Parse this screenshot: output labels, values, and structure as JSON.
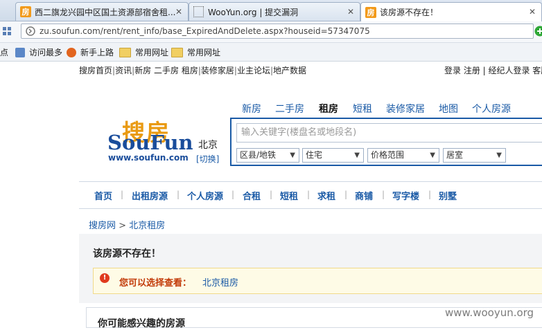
{
  "browser": {
    "tabs": [
      {
        "title": "西二旗龙兴园中区国土资源部宿舍租...",
        "favicon": "房"
      },
      {
        "title": "WooYun.org | 提交漏洞",
        "favicon": ""
      },
      {
        "title": "该房源不存在！",
        "favicon": "房"
      }
    ],
    "url": "zu.soufun.com/rent/rent_info/base_ExpiredAndDelete.aspx?houseid=57347075",
    "bookmarks": [
      "点",
      "访问最多",
      "新手上路",
      "常用网址",
      "常用网址"
    ]
  },
  "site": {
    "top_links": {
      "left": [
        "搜房首页",
        "资讯",
        "新房",
        "二手房",
        "租房",
        "装修家居",
        "业主论坛",
        "地产数据"
      ],
      "right": "登录 注册 | 经纪人登录 客服"
    },
    "logo": {
      "cn": "搜房",
      "en": "SouFun",
      "url": "www.soufun.com"
    },
    "city": "北京",
    "city_switch": "[切换]",
    "channel_tabs": [
      "新房",
      "二手房",
      "租房",
      "短租",
      "装修家居",
      "地图",
      "个人房源"
    ],
    "selected_channel": "租房",
    "search": {
      "placeholder": "输入关键字(楼盘名或地段名)",
      "filters": [
        "区县/地铁",
        "住宅",
        "价格范围",
        "居室"
      ]
    },
    "menu": [
      "首页",
      "出租房源",
      "个人房源",
      "合租",
      "短租",
      "求租",
      "商铺",
      "写字楼",
      "别墅"
    ],
    "breadcrumb": {
      "home": "搜房网",
      "sep": ">",
      "current": "北京租房"
    },
    "message": {
      "title": "该房源不存在！",
      "notice_label": "您可以选择查看：",
      "notice_link": "北京租房"
    },
    "bottom_heading": "你可能感兴趣的房源"
  },
  "watermark": "www.wooyun.org"
}
